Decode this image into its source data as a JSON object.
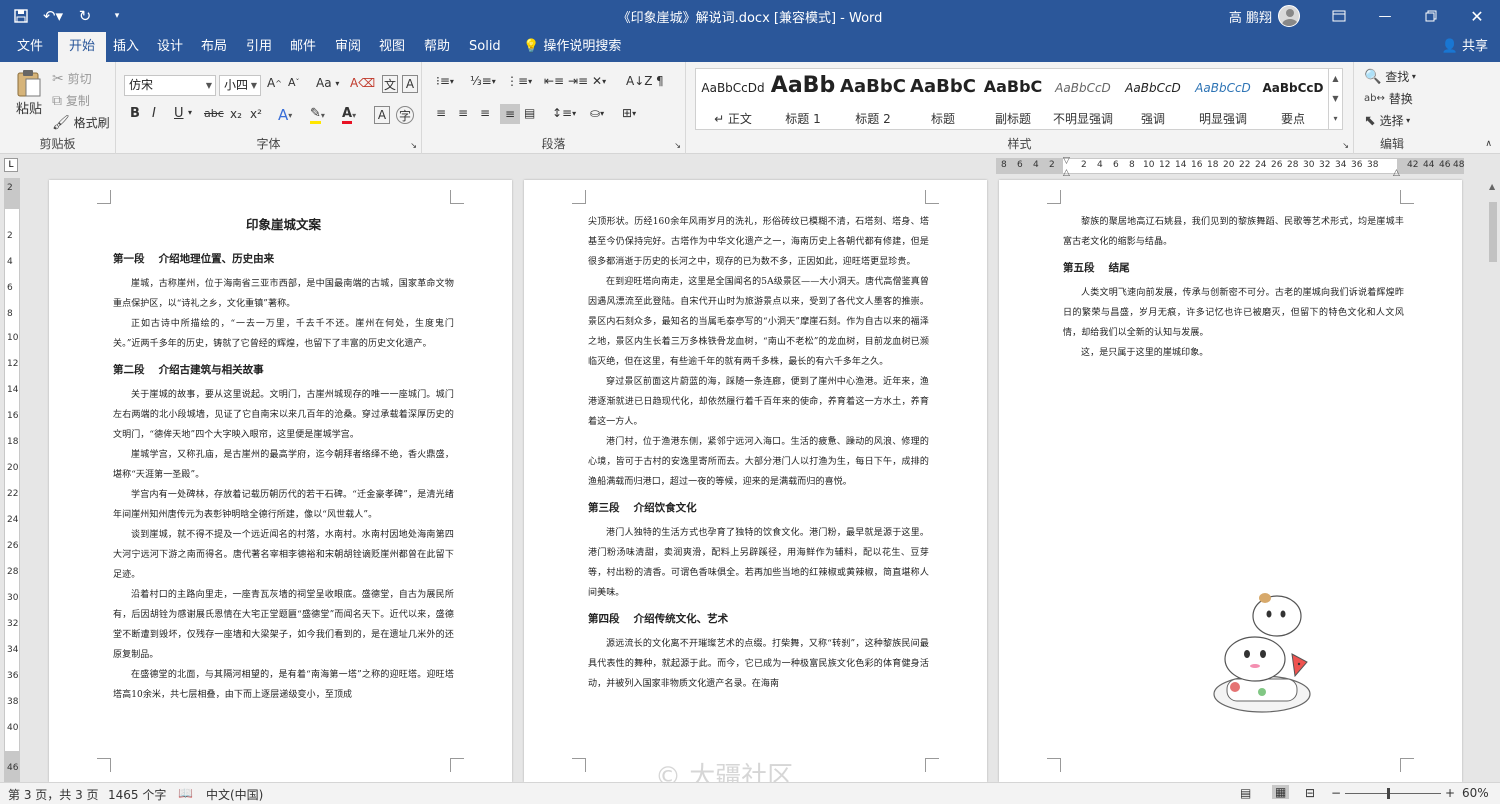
{
  "window": {
    "title": "《印象崖城》解说词.docx [兼容模式] - Word",
    "user": "高 鹏翔",
    "share_label": "共享"
  },
  "qat": {
    "save_icon": "save-icon",
    "undo_icon": "undo-icon",
    "redo_icon": "redo-icon",
    "customize_icon": "customize-qat-icon"
  },
  "tabs": [
    "文件",
    "开始",
    "插入",
    "设计",
    "布局",
    "引用",
    "邮件",
    "审阅",
    "视图",
    "帮助",
    "Solid",
    "操作说明搜索"
  ],
  "active_tab": "开始",
  "ribbon": {
    "clipboard": {
      "paste": "粘贴",
      "cut": "剪切",
      "copy": "复制",
      "format_painter": "格式刷",
      "label": "剪贴板"
    },
    "font": {
      "font_name": "仿宋",
      "font_size": "小四",
      "label": "字体",
      "aa_label": "Aa",
      "bold": "B",
      "italic": "I",
      "underline": "U",
      "strike": "abc",
      "sub": "x₂",
      "sup": "x²"
    },
    "paragraph": {
      "label": "段落"
    },
    "styles": {
      "label": "样式",
      "items": [
        {
          "sample": "AaBbCcDd",
          "name": "↵ 正文"
        },
        {
          "sample": "AaBb",
          "name": "标题 1"
        },
        {
          "sample": "AaBbC",
          "name": "标题 2"
        },
        {
          "sample": "AaBbC",
          "name": "标题"
        },
        {
          "sample": "AaBbC",
          "name": "副标题"
        },
        {
          "sample": "AaBbCcD",
          "name": "不明显强调"
        },
        {
          "sample": "AaBbCcD",
          "name": "强调"
        },
        {
          "sample": "AaBbCcD",
          "name": "明显强调"
        },
        {
          "sample": "AaBbCcD",
          "name": "要点"
        }
      ]
    },
    "editing": {
      "find": "查找",
      "replace": "替换",
      "select": "选择",
      "label": "编辑"
    }
  },
  "ruler_numbers": [
    "8",
    "6",
    "4",
    "2",
    "2",
    "4",
    "6",
    "8",
    "10",
    "12",
    "14",
    "16",
    "18",
    "20",
    "22",
    "24",
    "26",
    "28",
    "30",
    "32",
    "34",
    "36",
    "38",
    "42",
    "44",
    "46",
    "48"
  ],
  "vruler_numbers": [
    "2",
    "2",
    "4",
    "6",
    "8",
    "10",
    "12",
    "14",
    "16",
    "18",
    "20",
    "22",
    "24",
    "26",
    "28",
    "30",
    "32",
    "34",
    "36",
    "38",
    "40",
    "46"
  ],
  "page1": {
    "title": "印象崖城文案",
    "sec1_heading": "第一段　 介绍地理位置、历史由来",
    "sec1_p1": "崖城，古称崖州，位于海南省三亚市西部，是中国最南端的古城，国家革命文物重点保护区，以“诗礼之乡，文化重镇”著称。",
    "sec1_p2": "正如古诗中所描绘的，“一去一万里，千去千不还。崖州在何处，生度鬼门关。”近两千多年的历史，铸就了它曾经的辉煌，也留下了丰富的历史文化遗产。",
    "sec2_heading": "第二段　 介绍古建筑与相关故事",
    "sec2_p1": "关于崖城的故事，要从这里说起。文明门，古崖州城现存的唯一一座城门。城门左右两端的北小段城墙，见证了它自南宋以来几百年的沧桑。穿过承载着深厚历史的文明门，“德侔天地”四个大字映入眼帘，这里便是崖城学宫。",
    "sec2_p2": "崖城学宫，又称孔庙，是古崖州的最高学府，迄今朝拜者络绎不绝，香火鼎盛，堪称“天涯第一圣殿”。",
    "sec2_p3": "学宫内有一处碑林，存放着记载历朝历代的若干石碑。“迁金豪孝碑”，是清光绪年间崖州知州唐传元为表彰钟明晗全德行所建，像以“风世载人”。",
    "sec2_p4": "谈到崖城，就不得不提及一个远近闻名的村落，水南村。水南村因地处海南第四大河宁远河下游之南而得名。唐代著名宰相李德裕和宋朝胡铨谪贬崖州都曾在此留下足迹。",
    "sec2_p5": "沿着村口的主路向里走，一座青瓦灰墙的祠堂呈收眼底。盛德堂，自古为展民所有，后因胡铨为感谢展氏恩情在大宅正堂题匾“盛德堂”而闻名天下。近代以来，盛德堂不断遭到毁坏，仅残存一座墙和大梁架子，如今我们看到的，是在遗址几米外的还原复制品。",
    "sec2_p6": "在盛德堂的北面，与其隔河相望的，是有着“南海第一塔”之称的迎旺塔。迎旺塔塔高10余米，共七层相叠，由下而上逐层递级变小，至顶成"
  },
  "page2": {
    "p1": "尖顶形状。历经160余年风雨岁月的洗礼，形俗砖纹已模糊不清，石塔刻、塔身、塔基至今仍保持完好。古塔作为中华文化遗产之一，海南历史上各朝代都有修建，但是很多都消逝于历史的长河之中，现存的已为数不多，正因如此，迎旺塔更显珍贵。",
    "p2": "在到迎旺塔向南走，这里是全国闻名的5A级景区——大小洞天。唐代高僧鉴真曾因遇风漂流至此登陆。自宋代开山时为旅游景点以来，受到了各代文人墨客的推崇。景区内石刻众多，最知名的当属毛泰亭写的“小洞天”摩崖石刻。作为自古以来的福泽之地，景区内生长着三万多株铁骨龙血树，“南山不老松”的龙血树，目前龙血树已濒临灭绝，但在这里，有些逾千年的就有两千多株，最长的有六千多年之久。",
    "p3": "穿过景区前面这片蔚蓝的海，踩随一条连廊，便到了崖州中心渔港。近年来，渔港逐渐就进已日趋现代化，却依然履行着千百年来的使命，养育着这一方水土，养育着这一方人。",
    "p4": "港门村，位于渔港东侧，紧邻宁远河入海口。生活的疲惫、躁动的风浪、修理的心境，皆可于古村的安逸里寄所而去。大部分港门人以打渔为生，每日下午，成排的渔船满载而归港口，超过一夜的等候，迎来的是满载而归的喜悦。",
    "sec3_heading": "第三段　 介绍饮食文化",
    "p5": "港门人独特的生活方式也孕育了独特的饮食文化。港门粉，最早就是源于这里。港门粉汤味清甜，卖润爽滑，配料上另辟蹊径，用海鲜作为辅料，配以花生、豆芽等，村出粉的清香。可谓色香味俱全。若再加些当地的红辣椒或黄辣椒，简直堪称人间美味。",
    "sec4_heading": "第四段　 介绍传统文化、艺术",
    "p6": "源远流长的文化离不开璀璨艺术的点缀。打柴舞，又称“转刹”，这种黎族民间最具代表性的舞种，就起源于此。而今，它已成为一种极富民族文化色彩的体育健身活动，并被列入国家非物质文化遗产名录。在海南"
  },
  "page3": {
    "p1": "黎族的聚居地高辽石姚县，我们见到的黎族舞蹈、民歌等艺术形式，均是崖城丰富古老文化的缩影与结晶。",
    "sec5_heading": "第五段　 结尾",
    "p2": "人类文明飞速向前发展，传承与创新密不可分。古老的崖城向我们诉说着辉煌昨日的繁荣与昌盛，岁月无痕，许多记忆也许已被磨灭，但留下的特色文化和人文风情，却给我们以全新的认知与发展。",
    "p3": "这，是只属于这里的崖城印象。"
  },
  "watermark": "© 大疆社区",
  "status": {
    "page": "第 3 页，共 3 页",
    "words": "1465 个字",
    "lang": "中文(中国)",
    "zoom": "60%",
    "zoom_fraction": 0.45
  },
  "colors": {
    "titlebar": "#2b579a",
    "ribbon": "#f3f3f3",
    "canvas": "#e6e6e6"
  }
}
